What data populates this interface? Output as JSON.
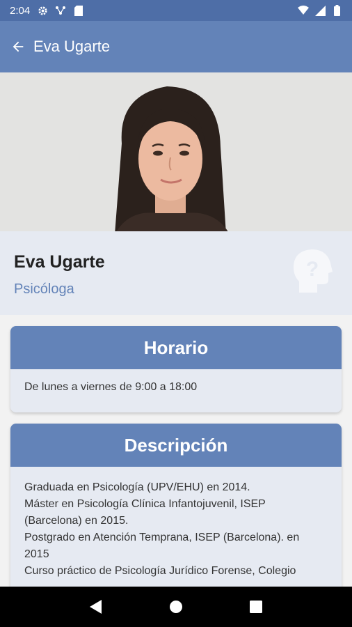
{
  "status_bar": {
    "time": "2:04",
    "icons": [
      "settings-icon",
      "network-icon",
      "sd-card-icon",
      "wifi-icon",
      "signal-icon",
      "battery-icon"
    ]
  },
  "app_bar": {
    "title": "Eva Ugarte",
    "back_icon": "arrow-back-icon"
  },
  "profile": {
    "name": "Eva Ugarte",
    "role": "Psicóloga",
    "icon": "head-question-icon"
  },
  "horario": {
    "title": "Horario",
    "text": "De lunes a viernes de 9:00 a 18:00"
  },
  "descripcion": {
    "title": "Descripción",
    "lines": [
      "Graduada en Psicología (UPV/EHU) en 2014.",
      "Máster en Psicología Clínica Infantojuvenil, ISEP",
      "(Barcelona) en 2015.",
      "Postgrado en Atención Temprana, ISEP (Barcelona). en",
      "2015",
      "Curso práctico de Psicología Jurídico Forense, Colegio"
    ]
  },
  "nav_bar": {
    "icons": [
      "back-triangle-icon",
      "home-circle-icon",
      "recents-square-icon"
    ]
  },
  "colors": {
    "primary": "#6383b8",
    "status_bar": "#4e6ea7",
    "card_bg": "#e6eaf2"
  }
}
